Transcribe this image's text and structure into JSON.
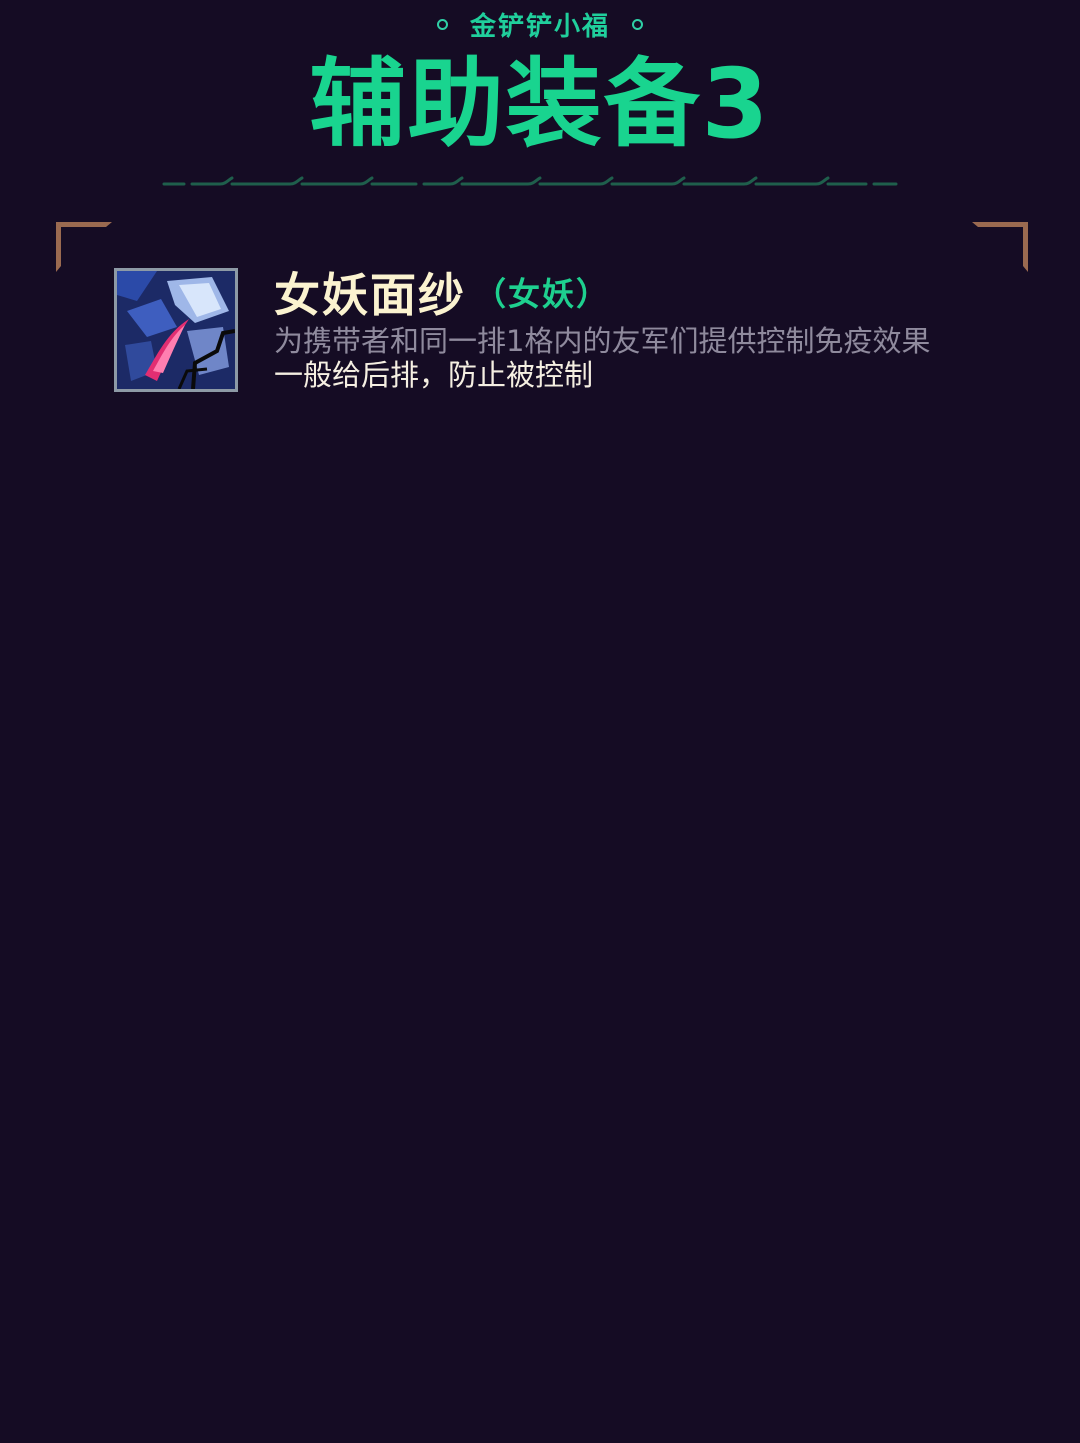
{
  "header": {
    "author": "金铲铲小福",
    "title": "辅助装备3"
  },
  "item": {
    "name": "女妖面纱",
    "tag": "（女妖）",
    "description": "为携带者和同一排1格内的友军们提供控制免疫效果",
    "note": "一般给后排，防止被控制",
    "icon": "banshee-veil-icon"
  },
  "colors": {
    "background": "#150c24",
    "accent_green": "#19d48f",
    "item_name": "#fbf3d0",
    "description_gray": "#8f8a9d",
    "note_white": "#f5efe2",
    "corner_bronze": "#9a6a50"
  }
}
